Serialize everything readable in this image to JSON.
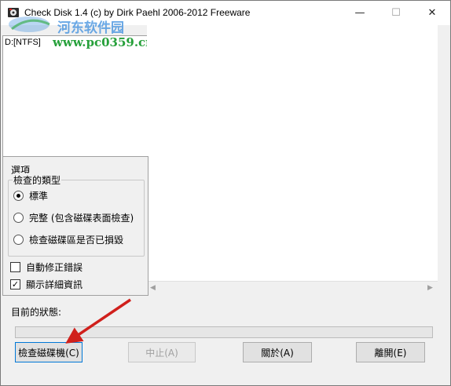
{
  "window": {
    "title": "Check Disk 1.4  (c) by Dirk Paehl  2006-2012 Freeware",
    "minimize_glyph": "—",
    "maximize_glyph": "☐",
    "close_glyph": "✕"
  },
  "watermark": {
    "text": "河东软件园",
    "url": "www.pc0359.cn"
  },
  "drives": {
    "items": [
      {
        "label": "D:[NTFS]"
      }
    ]
  },
  "options": {
    "title": "選項",
    "group_label": "檢查的類型",
    "radios": [
      {
        "label": "標準",
        "selected": true
      },
      {
        "label": "完整 (包含磁碟表面檢查)",
        "selected": false
      },
      {
        "label": "檢查磁碟區是否已損毀",
        "selected": false
      }
    ],
    "checkboxes": [
      {
        "label": "自動修正錯誤",
        "checked": false
      },
      {
        "label": "顯示詳細資訊",
        "checked": true
      }
    ]
  },
  "status": {
    "label": "目前的狀態:",
    "progress": 0
  },
  "buttons": {
    "check": "檢查磁碟機(C)",
    "abort": "中止(A)",
    "about": "關於(A)",
    "exit": "離開(E)"
  },
  "colors": {
    "arrow": "#d0201c",
    "default_button_border": "#0078d7",
    "watermark_text": "#3a8dde",
    "watermark_url": "#26a03a"
  },
  "icons": {
    "app": "disk-app-icon"
  }
}
